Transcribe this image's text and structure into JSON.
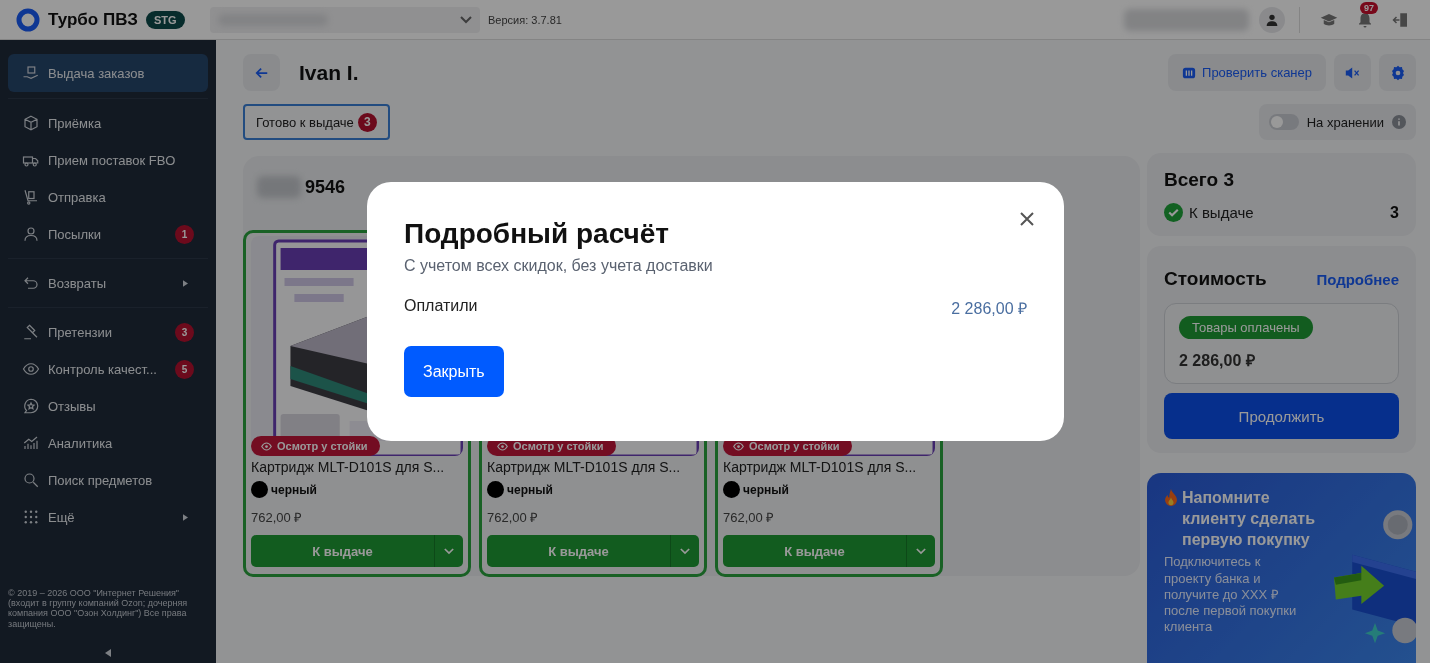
{
  "topbar": {
    "app_name": "Турбо ПВЗ",
    "env_badge": "STG",
    "version": "Версия: 3.7.81",
    "notifications": "97"
  },
  "sidebar": {
    "groups": [
      [
        {
          "label": "Выдача заказов",
          "selected": true
        }
      ],
      [
        {
          "label": "Приёмка",
          "selected": false
        },
        {
          "label": "Прием поставок FBO",
          "selected": false
        },
        {
          "label": "Отправка",
          "selected": false
        },
        {
          "label": "Посылки",
          "selected": false,
          "badge": "1"
        }
      ],
      [
        {
          "label": "Возвраты",
          "selected": false,
          "submenu": true
        }
      ],
      [
        {
          "label": "Претензии",
          "selected": false,
          "badge": "3"
        },
        {
          "label": "Контроль качест...",
          "selected": false,
          "badge": "5"
        },
        {
          "label": "Отзывы",
          "selected": false
        },
        {
          "label": "Аналитика",
          "selected": false
        },
        {
          "label": "Поиск предметов",
          "selected": false
        },
        {
          "label": "Ещё",
          "selected": false,
          "submenu": true
        }
      ]
    ],
    "footer": "© 2019 – 2026 ООО \"Интернет Решения\" (входит в группу компаний Ozon; дочерняя компания ООО \"Озон Холдинг\") Все права защищены."
  },
  "header": {
    "title": "Ivan I.",
    "scanner_button": "Проверить сканер"
  },
  "filters": [
    {
      "label": "Готово к выдаче",
      "count": "3",
      "selected": true
    }
  ],
  "storage_toggle": {
    "label": "На хранении",
    "on": false
  },
  "order": {
    "number": "9546"
  },
  "products": [
    {
      "badge": "Осмотр у стойки",
      "title": "Картридж MLT-D101S для S...",
      "color_name": "черный",
      "color": "#000000",
      "price": "762,00 ₽",
      "button": "К выдаче"
    },
    {
      "badge": "Осмотр у стойки",
      "title": "Картридж MLT-D101S для S...",
      "color_name": "черный",
      "color": "#000000",
      "price": "762,00 ₽",
      "button": "К выдаче"
    },
    {
      "badge": "Осмотр у стойки",
      "title": "Картридж MLT-D101S для S...",
      "color_name": "черный",
      "color": "#000000",
      "price": "762,00 ₽",
      "button": "К выдаче"
    }
  ],
  "summary": {
    "title": "Всего 3",
    "status": "К выдаче",
    "count": "3"
  },
  "cost": {
    "title": "Стоимость",
    "link": "Подробнее",
    "tag": "Товары оплачены",
    "amount": "2 286,00 ₽",
    "button": "Продолжить"
  },
  "promo": {
    "title": "Напомните клиенту сделать первую покупку",
    "text": "Подключитесь к проекту банка и получите до XXX ₽ после первой покупки клиента"
  },
  "modal": {
    "title": "Подробный расчёт",
    "subtitle": "С учетом всех скидок, без учета доставки",
    "row_label": "Оплатили",
    "row_value": "2 286,00 ₽",
    "button": "Закрыть"
  }
}
